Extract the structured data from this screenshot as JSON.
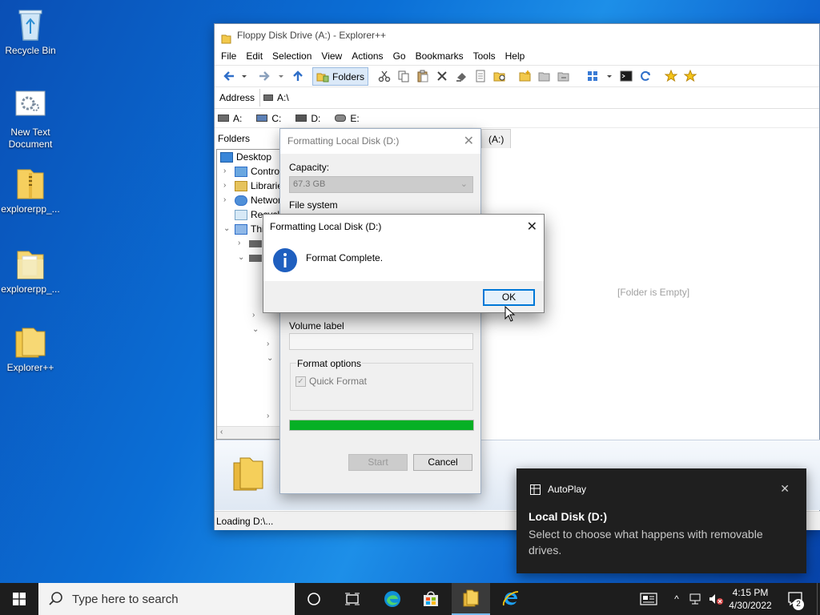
{
  "desktop": {
    "icons": [
      {
        "label": "Recycle Bin"
      },
      {
        "label": "New Text Document"
      },
      {
        "label": "explorerpp_..."
      },
      {
        "label": "explorerpp_..."
      },
      {
        "label": "Explorer++"
      }
    ]
  },
  "explorer": {
    "title": "Floppy Disk Drive (A:) - Explorer++",
    "menu": [
      "File",
      "Edit",
      "Selection",
      "View",
      "Actions",
      "Go",
      "Bookmarks",
      "Tools",
      "Help"
    ],
    "toolbar": {
      "folders_label": "Folders"
    },
    "address": {
      "label": "Address",
      "value": "A:\\"
    },
    "drives": [
      "A:",
      "C:",
      "D:",
      "E:"
    ],
    "folders_header": "Folders",
    "tree": [
      {
        "label": "Desktop"
      },
      {
        "label": "Contro"
      },
      {
        "label": "Librarie"
      },
      {
        "label": "Networ"
      },
      {
        "label": "Recycl"
      },
      {
        "label": "Thi"
      }
    ],
    "tab_label": "(A:)",
    "empty_message": "[Folder is Empty]",
    "status": "Loading D:\\..."
  },
  "format_dialog": {
    "title": "Formatting Local Disk (D:)",
    "capacity_label": "Capacity:",
    "capacity_value": "67.3 GB",
    "filesystem_label": "File system",
    "volume_label": "Volume label",
    "volume_value": "",
    "format_options_label": "Format options",
    "quick_format_label": "Quick Format",
    "quick_format_checked": true,
    "progress": 1.0,
    "start_label": "Start",
    "cancel_label": "Cancel"
  },
  "message_box": {
    "title": "Formatting Local Disk (D:)",
    "message": "Format Complete.",
    "ok_label": "OK"
  },
  "toast": {
    "app": "AutoPlay",
    "title": "Local Disk (D:)",
    "body": "Select to choose what happens with removable drives."
  },
  "taskbar": {
    "search_placeholder": "Type here to search",
    "time": "4:15 PM",
    "date": "4/30/2022",
    "notification_count": "2"
  },
  "colors": {
    "accent": "#0078d7",
    "progress": "#06b025",
    "taskbar": "#1d1d1d",
    "toast": "#1f1f1f"
  }
}
